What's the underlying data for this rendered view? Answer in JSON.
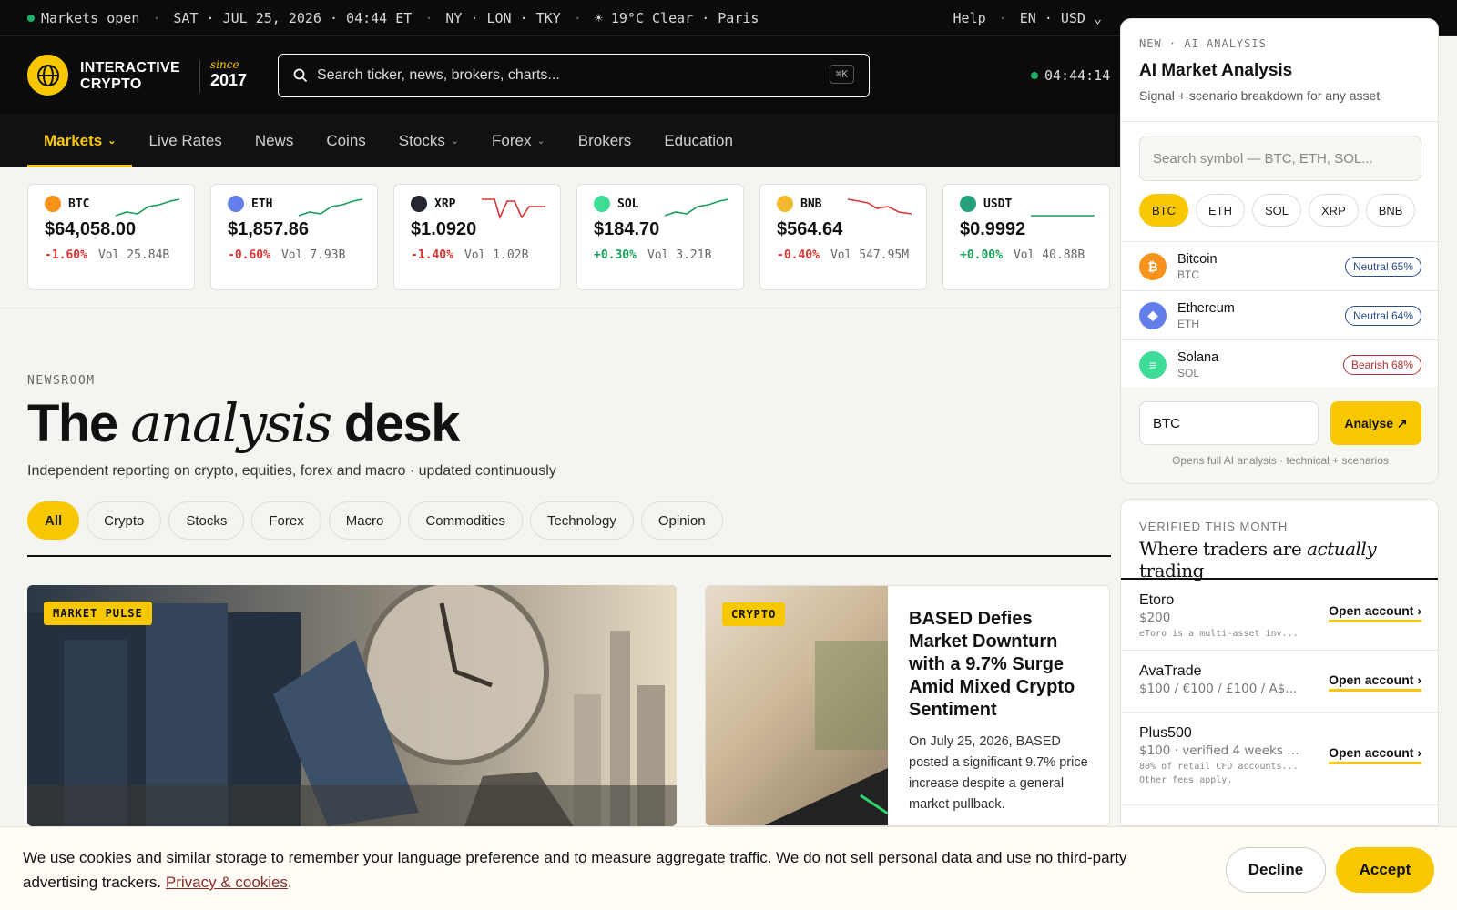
{
  "topbar": {
    "status": "Markets open",
    "date": "SAT · JUL 25, 2026 · 04:44 ET",
    "markets": "NY · LON · TKY",
    "weather": "☀ 19°C Clear · Paris",
    "help": "Help",
    "locale": "EN · USD ⌄"
  },
  "header": {
    "brand_line1": "INTERACTIVE",
    "brand_line2": "CRYPTO",
    "since": "since",
    "year": "2017",
    "search_placeholder": "Search ticker, news, brokers, charts...",
    "search_shortcut": "⌘K",
    "clock": "04:44:14"
  },
  "nav": {
    "items": [
      {
        "label": "Markets",
        "dropdown": true
      },
      {
        "label": "Live Rates"
      },
      {
        "label": "News"
      },
      {
        "label": "Coins"
      },
      {
        "label": "Stocks",
        "dropdown": true
      },
      {
        "label": "Forex",
        "dropdown": true
      },
      {
        "label": "Brokers"
      },
      {
        "label": "Education"
      }
    ],
    "chevron": "⌄"
  },
  "tickers": [
    {
      "symbol": "BTC",
      "price": "$64,058.00",
      "change": "-1.60%",
      "volume": "Vol 25.84B",
      "color": "#f7931a",
      "trend": "up"
    },
    {
      "symbol": "ETH",
      "price": "$1,857.86",
      "change": "-0.60%",
      "volume": "Vol 7.93B",
      "color": "#627eea",
      "trend": "up"
    },
    {
      "symbol": "XRP",
      "price": "$1.0920",
      "change": "-1.40%",
      "volume": "Vol 1.02B",
      "color": "#23292f",
      "trend": "down"
    },
    {
      "symbol": "SOL",
      "price": "$184.70",
      "change": "+0.30%",
      "volume": "Vol 3.21B",
      "color": "#3ddc97",
      "trend": "up"
    },
    {
      "symbol": "BNB",
      "price": "$564.64",
      "change": "-0.40%",
      "volume": "Vol 547.95M",
      "color": "#f3ba2f",
      "trend": "down"
    },
    {
      "symbol": "USDT",
      "price": "$0.9992",
      "change": "+0.00%",
      "volume": "Vol 40.88B",
      "color": "#26a17b",
      "trend": "flat"
    }
  ],
  "newsroom": {
    "eyebrow": "NEWSROOM",
    "title_pre": "The",
    "title_em": "analysis",
    "title_post": "desk",
    "subtitle": "Independent reporting on crypto, equities, forex and macro · updated continuously",
    "filters": [
      "All",
      "Crypto",
      "Stocks",
      "Forex",
      "Macro",
      "Commodities",
      "Technology",
      "Opinion"
    ]
  },
  "cards": {
    "main_tag": "MARKET PULSE",
    "side_tag": "CRYPTO",
    "side_title": "BASED Defies Market Downturn with a 9.7% Surge Amid Mixed Crypto Sentiment",
    "side_desc": "On July 25, 2026, BASED posted a significant 9.7% price increase despite a general market pullback."
  },
  "ai_panel": {
    "eyebrow": "NEW · AI ANALYSIS",
    "title": "AI Market Analysis",
    "subtitle": "Signal + scenario breakdown for any asset",
    "search_placeholder": "Search symbol — BTC, ETH, SOL...",
    "chips": [
      "BTC",
      "ETH",
      "SOL",
      "XRP",
      "BNB"
    ],
    "assets": [
      {
        "name": "Bitcoin",
        "ticker": "BTC",
        "signal": "Neutral 65%",
        "kind": "neutral",
        "color": "#f7931a",
        "glyph": "₿"
      },
      {
        "name": "Ethereum",
        "ticker": "ETH",
        "signal": "Neutral 64%",
        "kind": "neutral",
        "color": "#627eea",
        "glyph": "◆"
      },
      {
        "name": "Solana",
        "ticker": "SOL",
        "signal": "Bearish 68%",
        "kind": "bearish",
        "color": "#3ddc97",
        "glyph": "≡"
      }
    ],
    "input_value": "BTC",
    "button": "Analyse ↗",
    "note": "Opens full AI analysis · technical + scenarios"
  },
  "brokers": {
    "eyebrow": "VERIFIED THIS MONTH",
    "title_pre": "Where traders are",
    "title_em": "actually",
    "title_post": "trading",
    "items": [
      {
        "name": "Etoro",
        "price": "$200",
        "disclaimer": "eToro is a multi-asset inv...",
        "cta": "Open account ›"
      },
      {
        "name": "AvaTrade",
        "price": "$100 / €100 / £100 / A$...",
        "disclaimer": "",
        "cta": "Open account ›"
      },
      {
        "name": "Plus500",
        "price": "$100 · verified 4 weeks a...",
        "disclaimer": "80% of retail CFD accounts...",
        "disclaimer2": "Other fees apply.",
        "cta": "Open account ›"
      }
    ]
  },
  "cookie": {
    "text": "We use cookies and similar storage to remember your language preference and to measure aggregate traffic. We do not sell personal data and use no third-party advertising trackers.",
    "link": "Privacy & cookies",
    "decline": "Decline",
    "accept": "Accept"
  }
}
